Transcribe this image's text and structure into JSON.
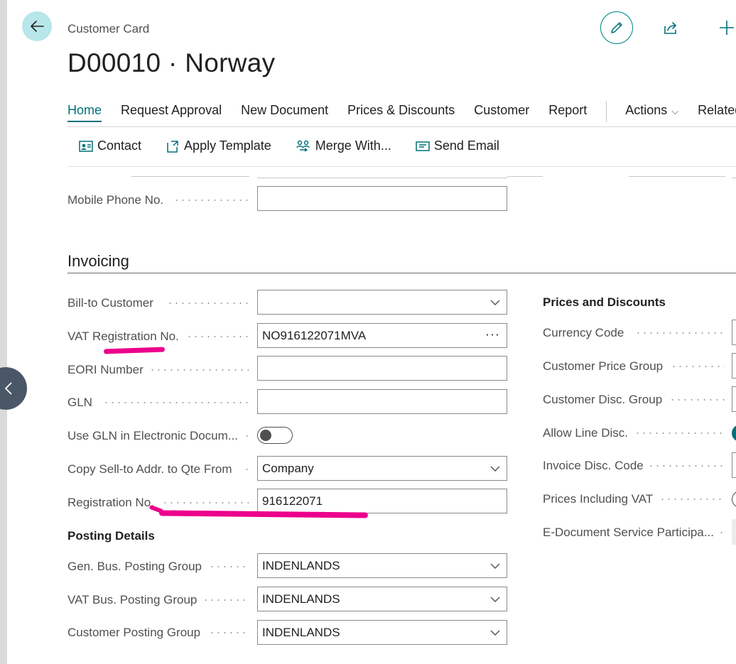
{
  "header": {
    "subtitle": "Customer Card",
    "title": "D00010 · Norway"
  },
  "tabs": [
    {
      "label": "Home",
      "active": true
    },
    {
      "label": "Request Approval"
    },
    {
      "label": "New Document"
    },
    {
      "label": "Prices & Discounts"
    },
    {
      "label": "Customer"
    },
    {
      "label": "Report"
    },
    {
      "label": "Actions"
    },
    {
      "label": "Related"
    }
  ],
  "actions": {
    "contact": "Contact",
    "apply_template": "Apply Template",
    "merge_with": "Merge With...",
    "send_email": "Send Email"
  },
  "contact_fields": {
    "mobile_phone_label": "Mobile Phone No.",
    "mobile_phone_value": ""
  },
  "invoicing": {
    "title": "Invoicing",
    "bill_to_customer": {
      "label": "Bill-to Customer",
      "value": ""
    },
    "vat_registration": {
      "label": "VAT Registration No.",
      "value": "NO916122071MVA"
    },
    "eori_number": {
      "label": "EORI Number",
      "value": ""
    },
    "gln": {
      "label": "GLN",
      "value": ""
    },
    "use_gln": {
      "label": "Use GLN in Electronic Docum...",
      "value": false
    },
    "copy_sell_to": {
      "label": "Copy Sell-to Addr. to Qte From",
      "value": "Company"
    },
    "registration_no": {
      "label": "Registration No.",
      "value": "916122071"
    },
    "posting_details_title": "Posting Details",
    "gen_bus_posting": {
      "label": "Gen. Bus. Posting Group",
      "value": "INDENLANDS"
    },
    "vat_bus_posting": {
      "label": "VAT Bus. Posting Group",
      "value": "INDENLANDS"
    },
    "customer_posting": {
      "label": "Customer Posting Group",
      "value": "INDENLANDS"
    }
  },
  "prices_discounts": {
    "title": "Prices and Discounts",
    "currency_code": "Currency Code",
    "customer_price_group": "Customer Price Group",
    "customer_disc_group": "Customer Disc. Group",
    "allow_line_disc": "Allow Line Disc.",
    "invoice_disc_code": "Invoice Disc. Code",
    "prices_including_vat": "Prices Including VAT",
    "e_document_service": "E-Document Service Participa..."
  },
  "colors": {
    "accent": "#00707a",
    "highlight": "#ec008c",
    "back_button": "#b8e6ea"
  }
}
